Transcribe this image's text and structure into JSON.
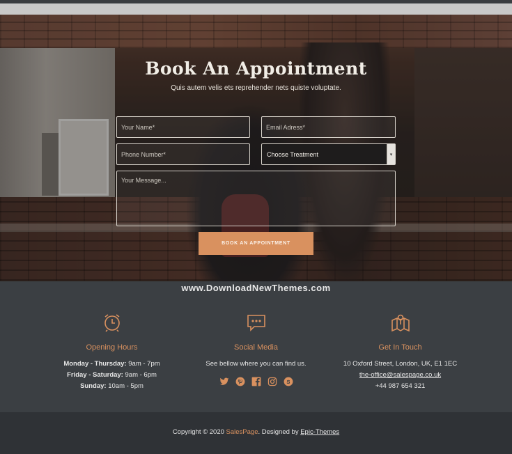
{
  "hero": {
    "title": "Book An Appointment",
    "subtitle": "Quis autem velis ets reprehender nets quiste voluptate."
  },
  "form": {
    "name_placeholder": "Your Name*",
    "email_placeholder": "Email Adress*",
    "phone_placeholder": "Phone Number*",
    "treatment_selected": "Choose Treatment",
    "message_placeholder": "Your Message...",
    "submit_label": "BOOK AN APPOINTMENT"
  },
  "watermark": "www.DownloadNewThemes.com",
  "footer": {
    "hours": {
      "title": "Opening Hours",
      "rows": [
        {
          "day": "Monday - Thursday:",
          "time": "9am - 7pm"
        },
        {
          "day": "Friday - Saturday:",
          "time": "9am - 6pm"
        },
        {
          "day": "Sunday:",
          "time": "10am - 5pm"
        }
      ]
    },
    "social": {
      "title": "Social Media",
      "text": "See bellow where you can find us."
    },
    "contact": {
      "title": "Get In Touch",
      "address": "10 Oxford Street, London, UK, E1 1EC",
      "email": "the-office@salespage.co.uk",
      "phone": "+44 987 654 321"
    }
  },
  "copyright": {
    "prefix": "Copyright © 2020 ",
    "brand": "SalesPage",
    "middle": ". Designed by ",
    "designer": "Epic-Themes"
  },
  "colors": {
    "accent": "#d9915f",
    "footer_bg": "#3b3f43",
    "bottom_bg": "#2f3236"
  }
}
